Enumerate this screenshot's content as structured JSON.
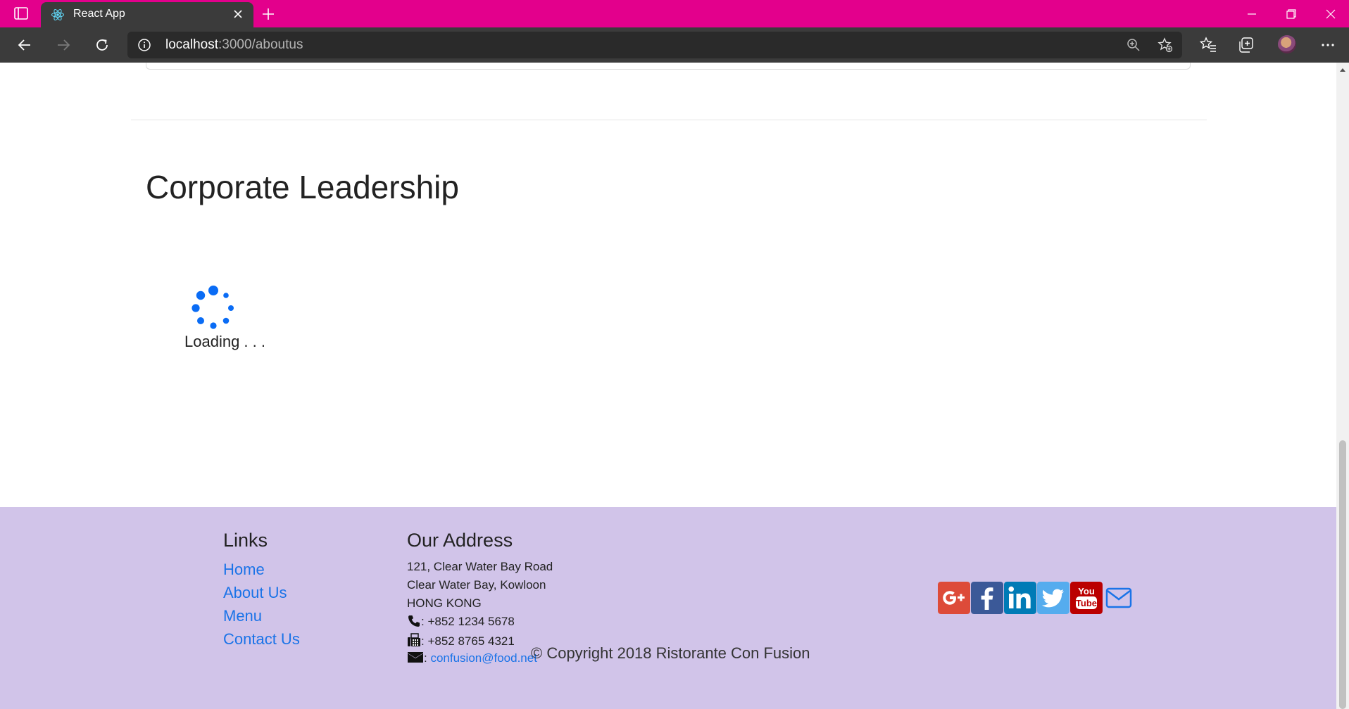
{
  "browser": {
    "tab_title": "React App",
    "url_host": "localhost",
    "url_path": ":3000/aboutus",
    "accent_color": "#e3008c"
  },
  "page": {
    "heading": "Corporate Leadership",
    "loading_text": "Loading . . ."
  },
  "footer": {
    "links_title": "Links",
    "links": [
      "Home",
      "About Us",
      "Menu",
      "Contact Us"
    ],
    "address_title": "Our Address",
    "address_lines": [
      "121, Clear Water Bay Road",
      "Clear Water Bay, Kowloon",
      "HONG KONG"
    ],
    "phone": ": +852 1234 5678",
    "fax": ": +852 8765 4321",
    "email_prefix": ": ",
    "email": "confusion@food.net",
    "copyright": "© Copyright 2018 Ristorante Con Fusion",
    "social": [
      {
        "icon": "google-plus-icon",
        "color": "#dd4b39"
      },
      {
        "icon": "facebook-icon",
        "color": "#3b5998"
      },
      {
        "icon": "linkedin-icon",
        "color": "#007bb6"
      },
      {
        "icon": "twitter-icon",
        "color": "#55acee"
      },
      {
        "icon": "youtube-icon",
        "color": "#bb0000"
      },
      {
        "icon": "mail-icon",
        "color": "#1a73e8"
      }
    ],
    "background_color": "#d1c4e9",
    "link_color": "#1a73e8"
  }
}
